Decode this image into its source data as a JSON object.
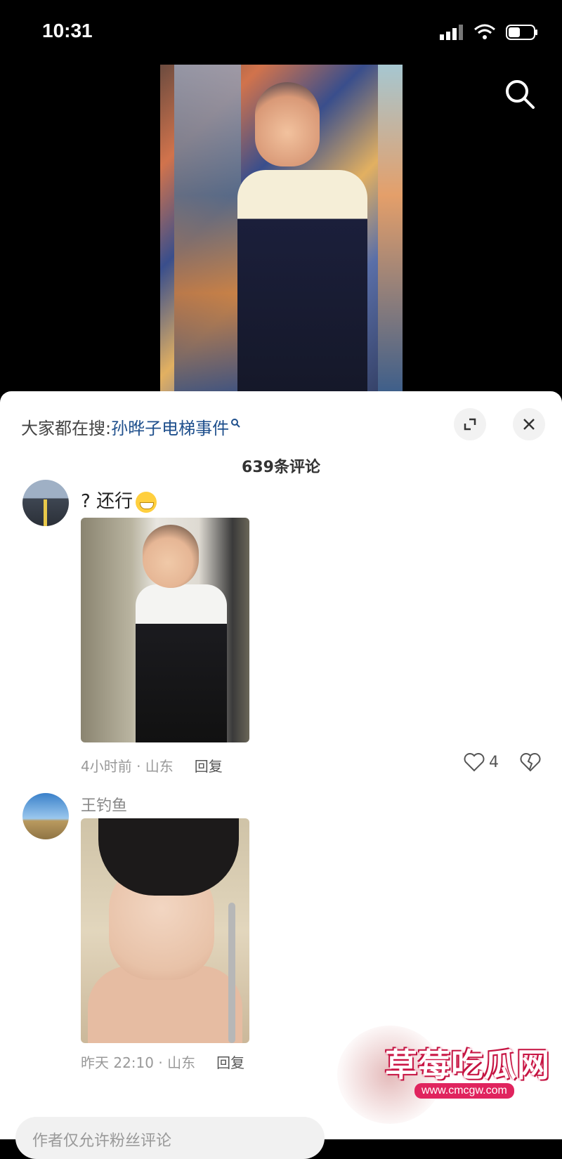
{
  "status": {
    "time": "10:31"
  },
  "search_bar": {
    "prefix": "大家都在搜:",
    "term": "孙晔子电梯事件"
  },
  "comments_header": {
    "count_text": "639条评论"
  },
  "comments": [
    {
      "username": "",
      "text": "? 还行",
      "time_location": "4小时前 · 山东",
      "reply_label": "回复",
      "likes": "4"
    },
    {
      "username": "王钓鱼",
      "text": "",
      "time_location": "昨天 22:10 · 山东",
      "reply_label": "回复"
    }
  ],
  "input_placeholder": "作者仅允许粉丝评论",
  "watermark": {
    "title": "草莓吃瓜网",
    "url": "www.cmcgw.com"
  },
  "colors": {
    "link": "#1e4f8c",
    "watermark": "#e0245e"
  }
}
